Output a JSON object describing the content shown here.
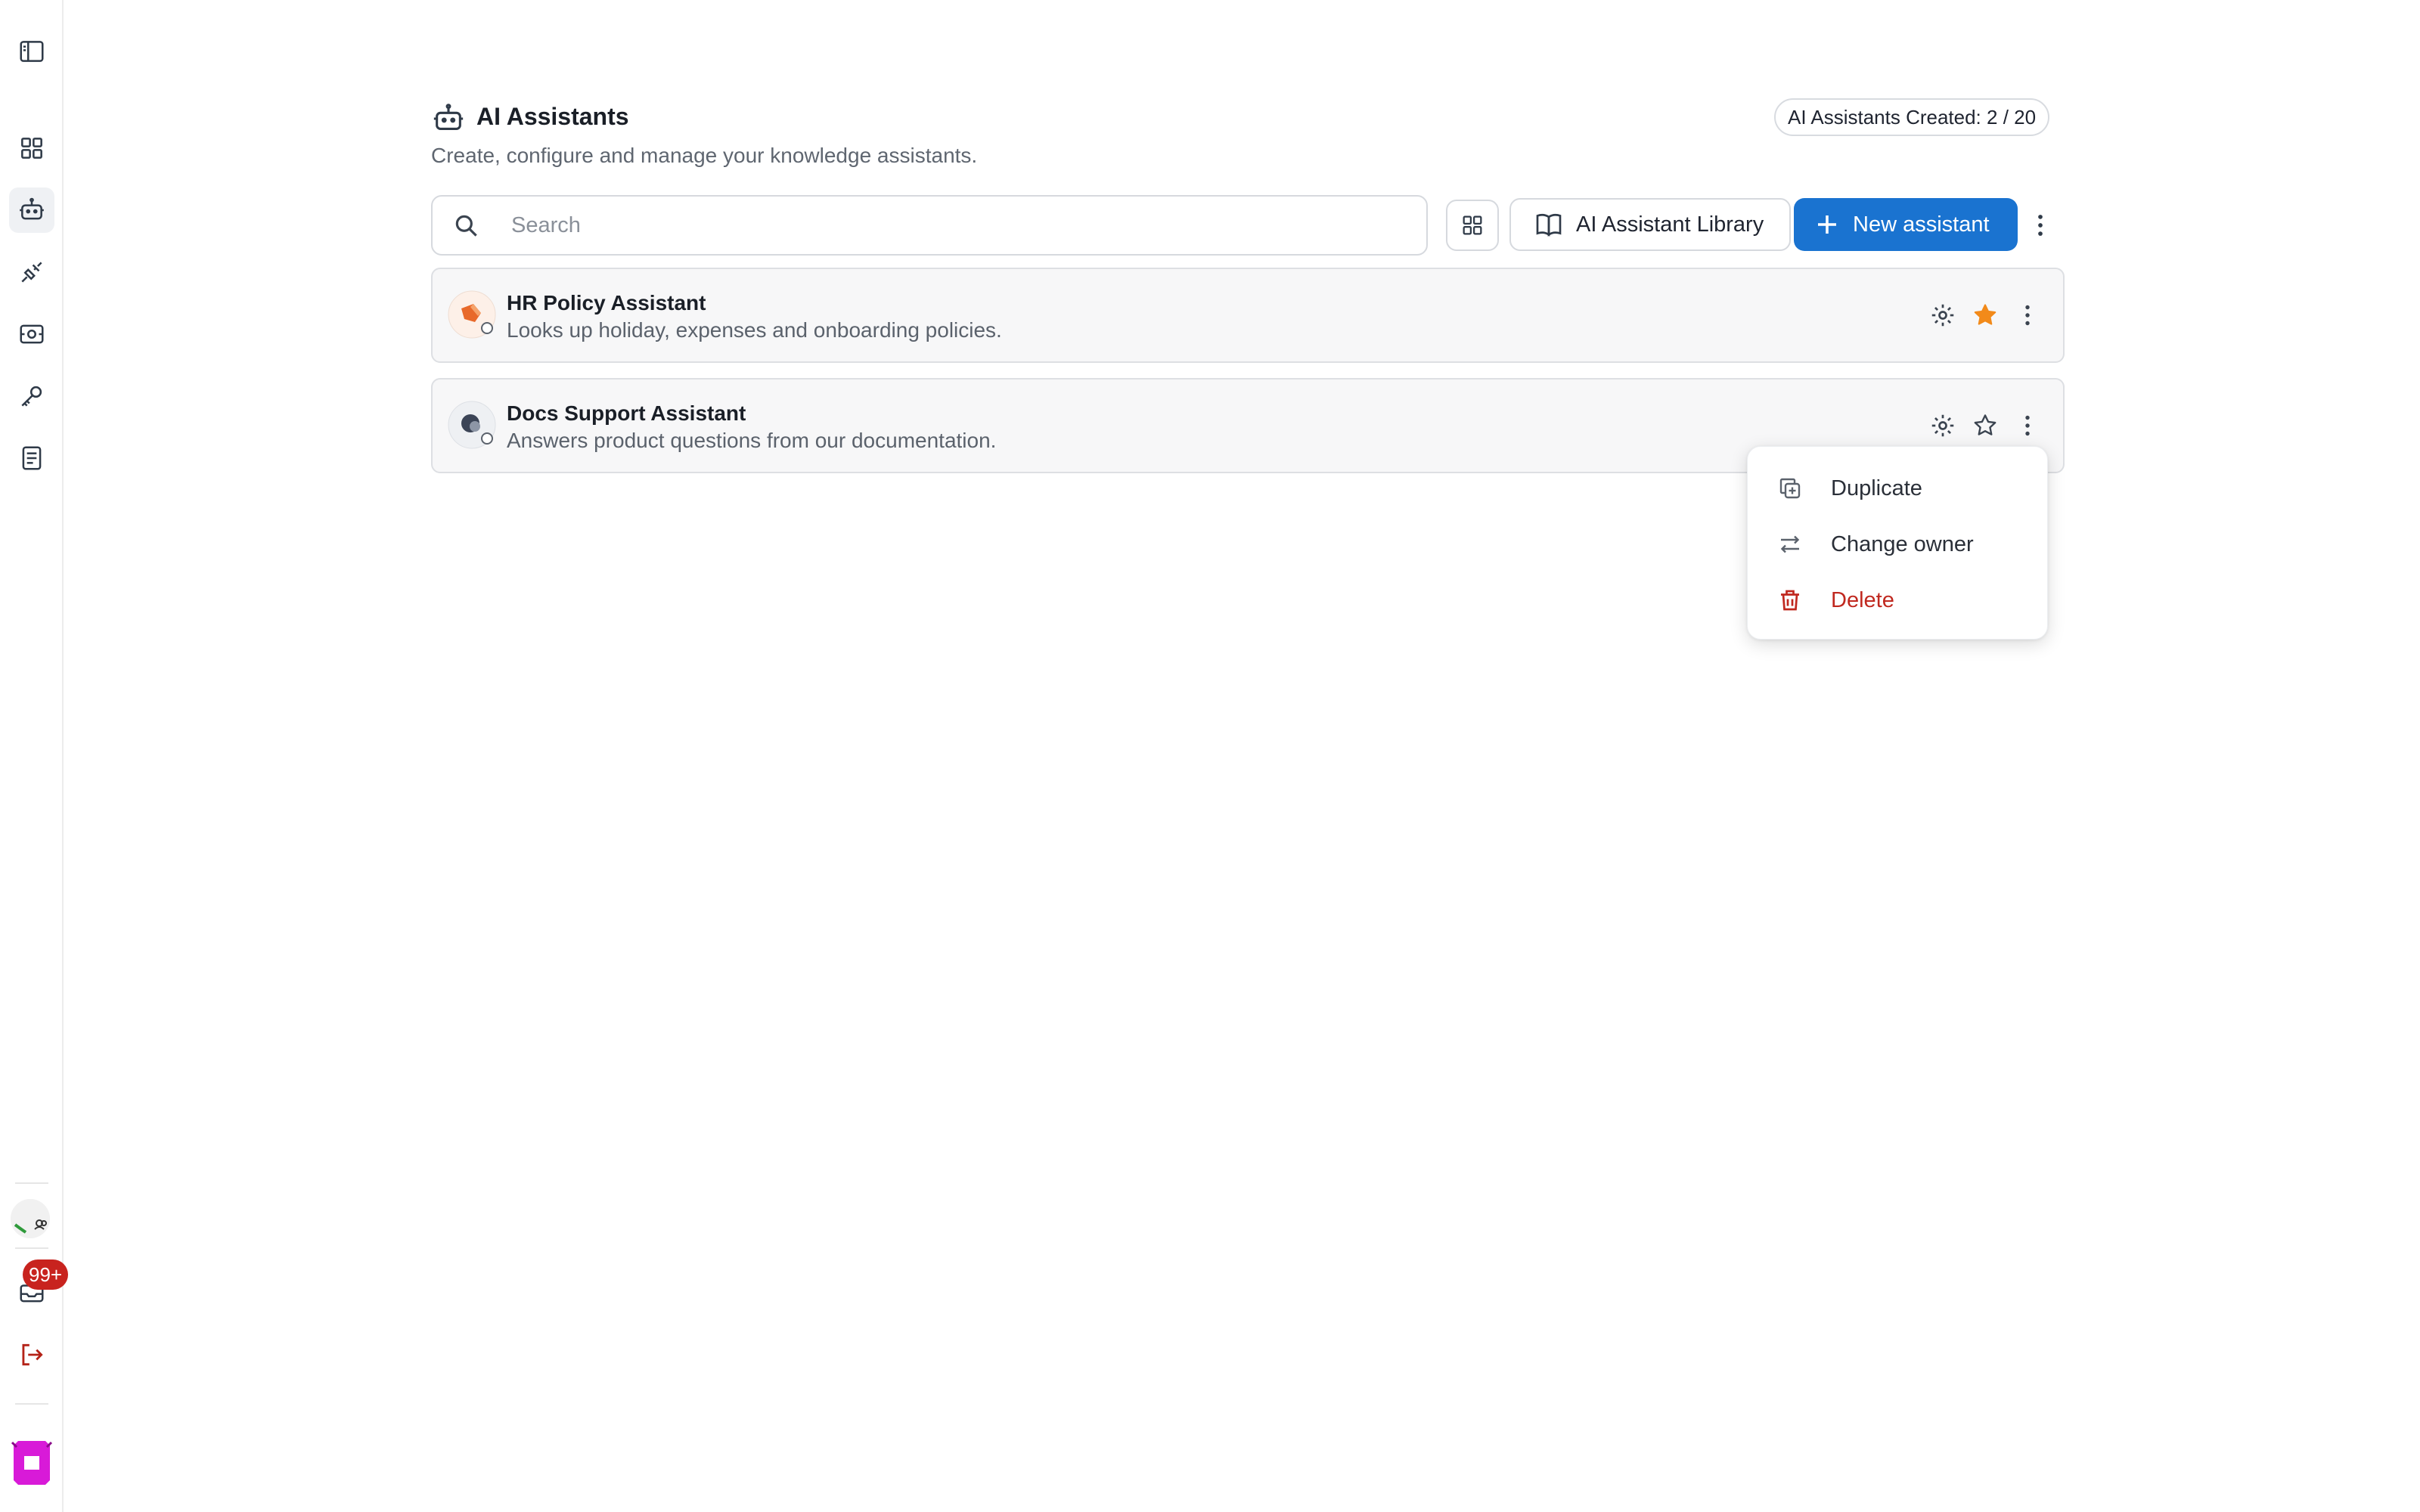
{
  "header": {
    "title": "AI Assistants",
    "subtitle": "Create, configure and manage your knowledge assistants.",
    "quota": "AI Assistants Created: 2 / 20"
  },
  "toolbar": {
    "search_placeholder": "Search",
    "library_label": "AI Assistant Library",
    "new_label": "New assistant"
  },
  "sidebar": {
    "items": [
      {
        "icon": "sidebar-toggle-icon"
      },
      {
        "icon": "dashboard-grid-icon"
      },
      {
        "icon": "robot-icon",
        "active": true
      },
      {
        "icon": "plug-icon"
      },
      {
        "icon": "integration-icon"
      },
      {
        "icon": "key-icon"
      },
      {
        "icon": "document-icon"
      }
    ],
    "notification_count": "99+"
  },
  "assistants": [
    {
      "name": "HR Policy Assistant",
      "description": "Looks up holiday, expenses and onboarding policies.",
      "favorite": true,
      "avatar_color": "#e8692a"
    },
    {
      "name": "Docs Support Assistant",
      "description": "Answers product questions from our documentation.",
      "favorite": false,
      "avatar_color": "#3b4456"
    }
  ],
  "context_menu": {
    "items": [
      {
        "label": "Duplicate",
        "icon": "duplicate-icon"
      },
      {
        "label": "Change owner",
        "icon": "swap-icon"
      },
      {
        "label": "Delete",
        "icon": "trash-icon",
        "danger": true
      }
    ]
  },
  "colors": {
    "primary": "#1a73d0",
    "favorite_star": "#f28a1a",
    "danger": "#c0281f",
    "badge": "#c8231e"
  }
}
